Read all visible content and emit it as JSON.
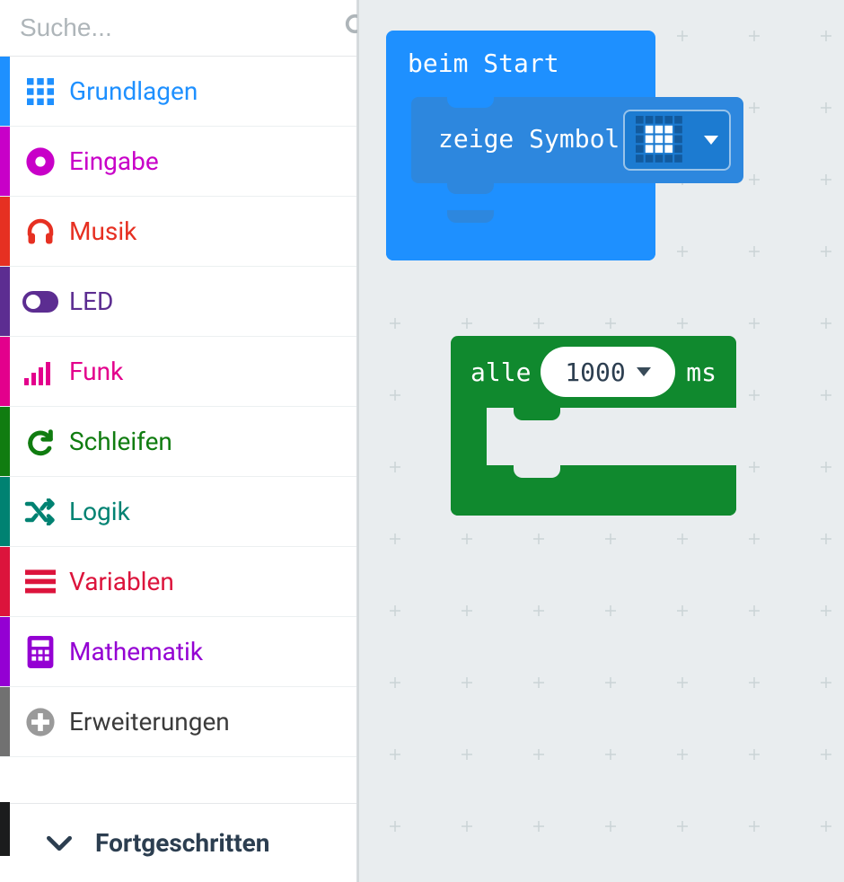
{
  "search": {
    "placeholder": "Suche..."
  },
  "sidebar": {
    "categories": [
      {
        "label": "Grundlagen",
        "color": "#1e90ff",
        "icon": "grid-icon"
      },
      {
        "label": "Eingabe",
        "color": "#c800c8",
        "icon": "record-icon"
      },
      {
        "label": "Musik",
        "color": "#e63022",
        "icon": "headphones-icon"
      },
      {
        "label": "LED",
        "color": "#5c2d91",
        "icon": "toggle-icon"
      },
      {
        "label": "Funk",
        "color": "#e3008c",
        "icon": "signal-icon"
      },
      {
        "label": "Schleifen",
        "color": "#107c10",
        "icon": "redo-icon"
      },
      {
        "label": "Logik",
        "color": "#008272",
        "icon": "shuffle-icon"
      },
      {
        "label": "Variablen",
        "color": "#dc143c",
        "icon": "list-icon"
      },
      {
        "label": "Mathematik",
        "color": "#9400d3",
        "icon": "calculator-icon"
      },
      {
        "label": "Erweiterungen",
        "color": "#717171",
        "icon": "plus-circle-icon"
      }
    ],
    "advanced_label": "Fortgeschritten"
  },
  "blocks": {
    "onstart": {
      "title": "beim Start",
      "show_icon_label": "zeige Symbol"
    },
    "loop": {
      "prefix": "alle",
      "value": "1000",
      "suffix": "ms"
    }
  }
}
